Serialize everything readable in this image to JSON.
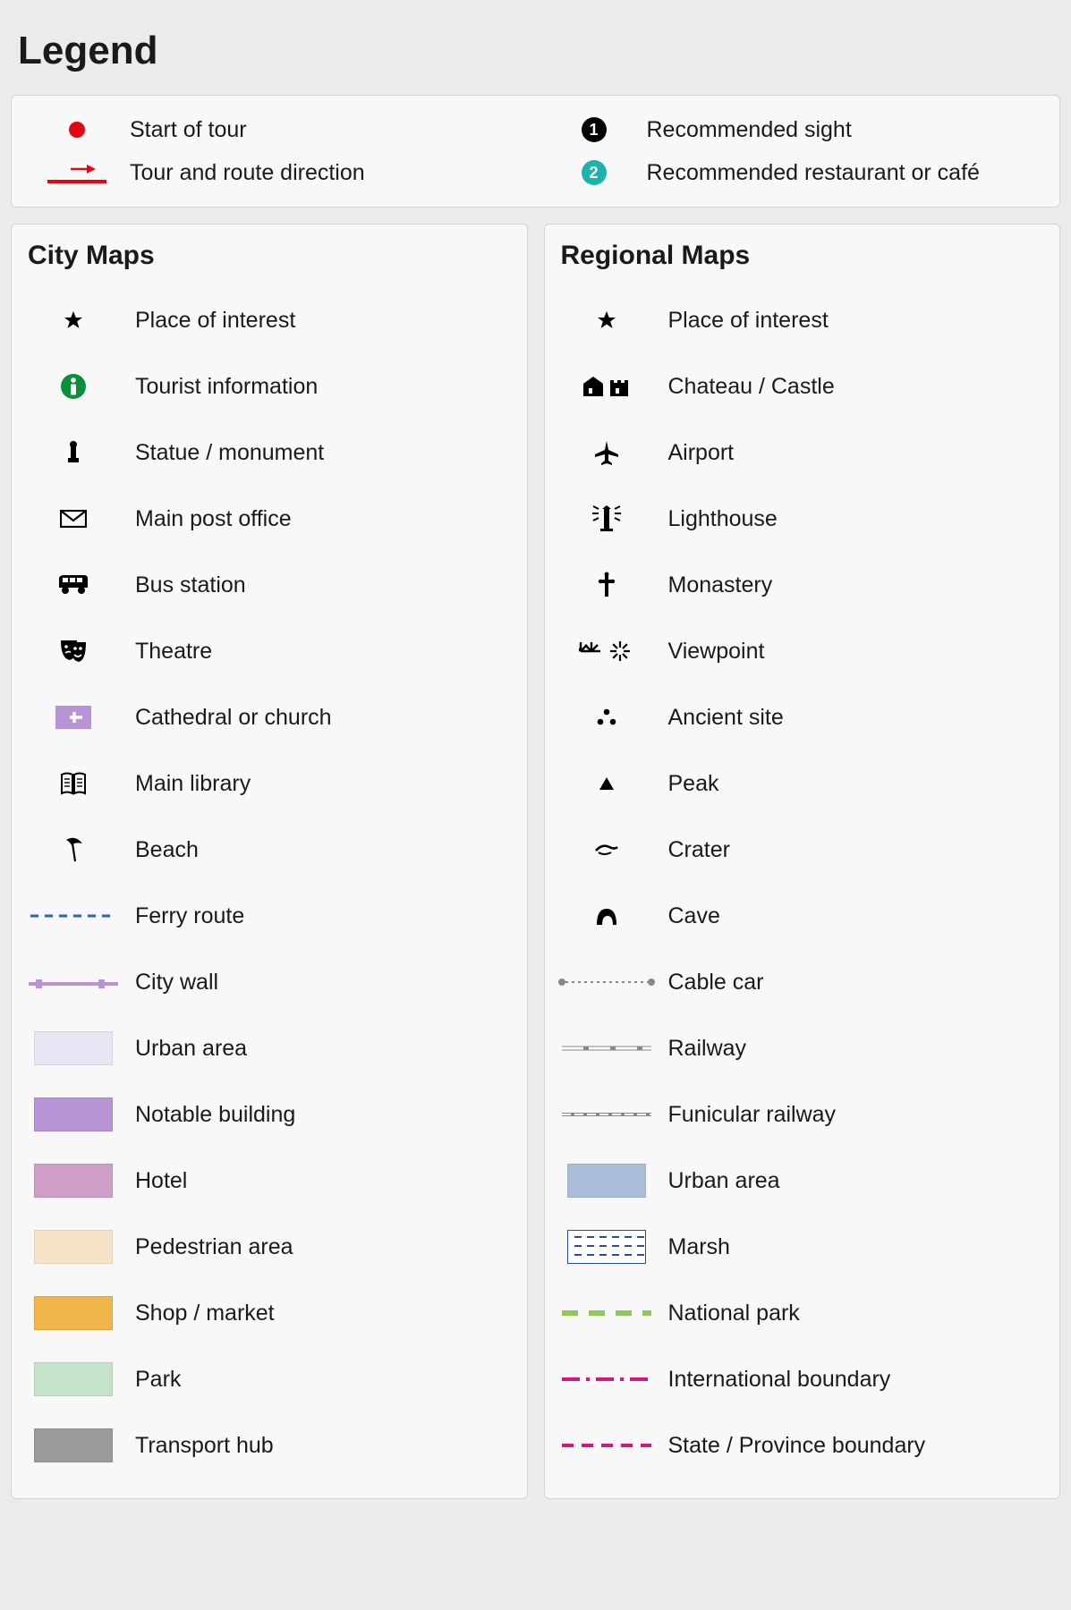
{
  "title": "Legend",
  "top": {
    "left": [
      {
        "icon": "red-dot",
        "label": "Start of tour"
      },
      {
        "icon": "red-arrow-line",
        "label": "Tour and route direction"
      }
    ],
    "right": [
      {
        "icon": "num-black-1",
        "label": "Recommended sight"
      },
      {
        "icon": "num-teal-2",
        "label": "Recommended restaurant or café"
      }
    ]
  },
  "city": {
    "title": "City Maps",
    "items": [
      {
        "icon": "star",
        "label": "Place of interest"
      },
      {
        "icon": "info",
        "label": "Tourist information"
      },
      {
        "icon": "statue",
        "label": "Statue / monument"
      },
      {
        "icon": "post",
        "label": "Main post office"
      },
      {
        "icon": "bus",
        "label": "Bus station"
      },
      {
        "icon": "theatre",
        "label": "Theatre"
      },
      {
        "icon": "church",
        "label": "Cathedral or church"
      },
      {
        "icon": "library",
        "label": "Main library"
      },
      {
        "icon": "beach",
        "label": "Beach"
      },
      {
        "icon": "ferry-line",
        "label": "Ferry route"
      },
      {
        "icon": "city-wall",
        "label": "City wall"
      },
      {
        "icon": "swatch-urban",
        "label": "Urban area"
      },
      {
        "icon": "swatch-notable",
        "label": "Notable building"
      },
      {
        "icon": "swatch-hotel",
        "label": "Hotel"
      },
      {
        "icon": "swatch-pedestrian",
        "label": "Pedestrian area"
      },
      {
        "icon": "swatch-shop",
        "label": "Shop / market"
      },
      {
        "icon": "swatch-park",
        "label": "Park"
      },
      {
        "icon": "swatch-transport",
        "label": "Transport hub"
      }
    ]
  },
  "regional": {
    "title": "Regional Maps",
    "items": [
      {
        "icon": "star",
        "label": "Place of interest"
      },
      {
        "icon": "castle",
        "label": "Chateau / Castle"
      },
      {
        "icon": "airport",
        "label": "Airport"
      },
      {
        "icon": "lighthouse",
        "label": "Lighthouse"
      },
      {
        "icon": "cross",
        "label": "Monastery"
      },
      {
        "icon": "viewpoint",
        "label": "Viewpoint"
      },
      {
        "icon": "ancient",
        "label": "Ancient site"
      },
      {
        "icon": "peak",
        "label": "Peak"
      },
      {
        "icon": "crater",
        "label": "Crater"
      },
      {
        "icon": "cave",
        "label": "Cave"
      },
      {
        "icon": "cablecar-line",
        "label": "Cable car"
      },
      {
        "icon": "railway-line",
        "label": "Railway"
      },
      {
        "icon": "funicular-line",
        "label": "Funicular railway"
      },
      {
        "icon": "swatch-regurban",
        "label": "Urban area"
      },
      {
        "icon": "swatch-marsh",
        "label": "Marsh"
      },
      {
        "icon": "natpark-line",
        "label": "National park"
      },
      {
        "icon": "intl-line",
        "label": "International boundary"
      },
      {
        "icon": "state-line",
        "label": "State / Province boundary"
      }
    ]
  },
  "colors": {
    "urban": "#e9e5f4",
    "notable": "#b893d6",
    "hotel": "#ce9ec7",
    "pedestrian": "#f7e3c8",
    "shop": "#f0b54b",
    "park": "#c4e3c8",
    "transport": "#9a9a9a",
    "regurban": "#a9bcd8",
    "marshBorder": "#2a4d9e"
  }
}
